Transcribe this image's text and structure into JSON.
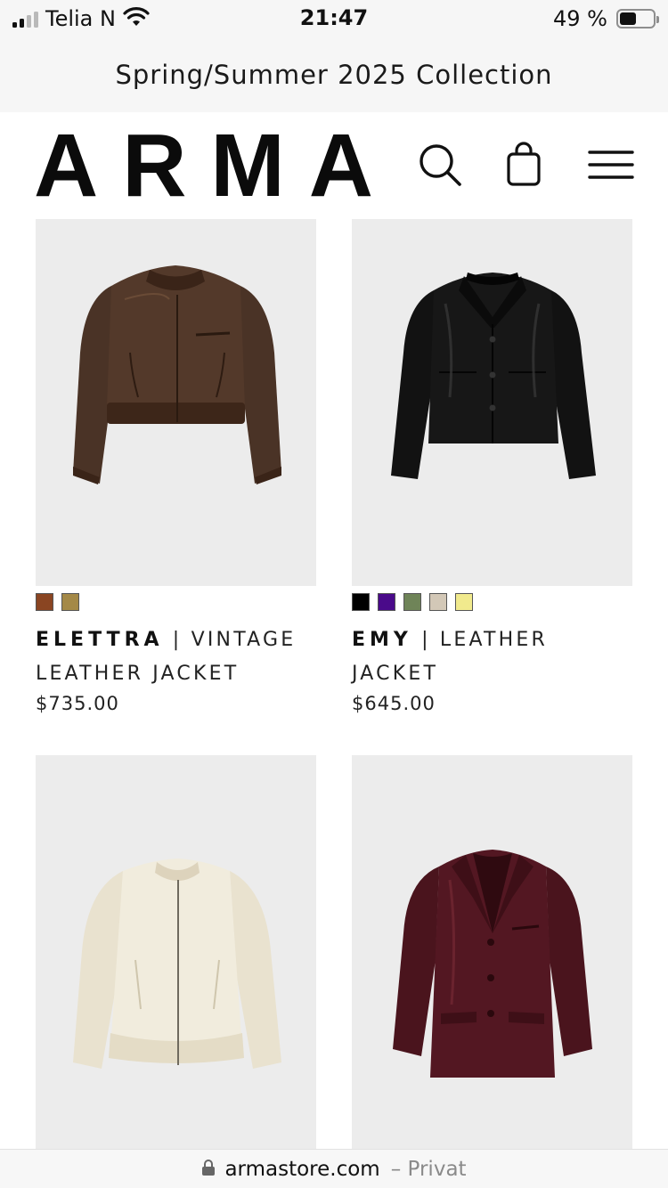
{
  "status_bar": {
    "carrier": "Telia N",
    "time": "21:47",
    "battery": "49 %",
    "battery_level": 0.49
  },
  "banner": {
    "text": "Spring/Summer 2025 Collection"
  },
  "header": {
    "logo": "ARMA",
    "icons": [
      "search-icon",
      "shopping-bag-icon",
      "hamburger-menu-icon"
    ]
  },
  "products": [
    {
      "brand": "ELETTRA",
      "separator": "|",
      "description": "VINTAGE LEATHER JACKET",
      "price": "$735.00",
      "swatches": [
        "#8a4522",
        "#a48947"
      ],
      "image": "brown-vintage-leather-bomber"
    },
    {
      "brand": "EMY",
      "separator": "|",
      "description": "LEATHER JACKET",
      "price": "$645.00",
      "swatches": [
        "#000000",
        "#4a0a8a",
        "#6f8458",
        "#d3c8b7",
        "#f1ea8d"
      ],
      "image": "black-leather-jacket"
    },
    {
      "image": "cream-bomber-jacket"
    },
    {
      "image": "burgundy-leather-blazer"
    }
  ],
  "address_bar": {
    "domain": "armastore.com",
    "separator": "–",
    "mode": "Privat"
  }
}
